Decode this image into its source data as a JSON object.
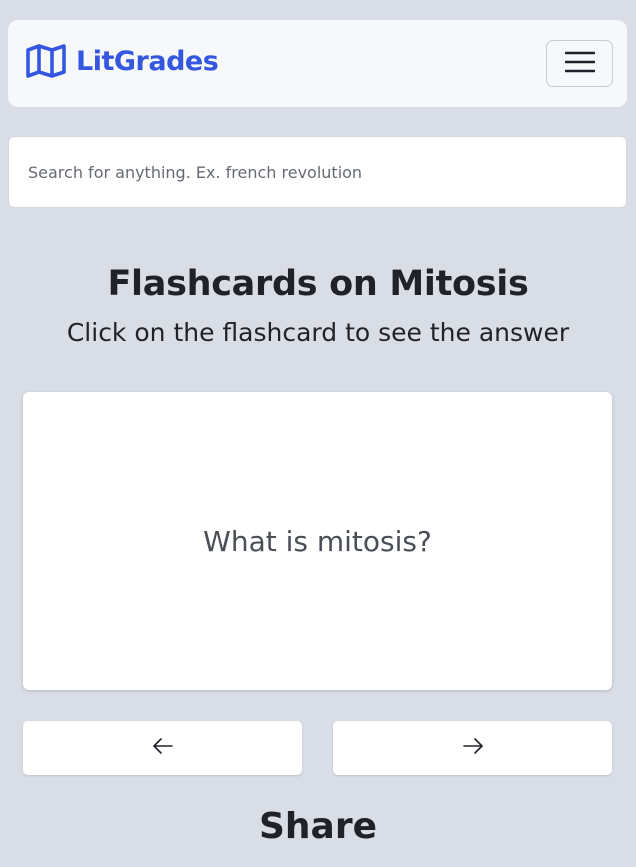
{
  "header": {
    "brand_name": "LitGrades",
    "brand_icon": "open-map-icon",
    "menu_icon": "hamburger-menu-icon"
  },
  "search": {
    "placeholder": "Search for anything. Ex. french revolution",
    "value": ""
  },
  "main": {
    "title": "Flashcards on Mitosis",
    "subtitle": "Click on the flashcard to see the answer"
  },
  "flashcard": {
    "question": "What is mitosis?"
  },
  "navigation": {
    "prev_icon": "arrow-left-icon",
    "next_icon": "arrow-right-icon"
  },
  "share": {
    "heading": "Share"
  },
  "colors": {
    "background": "#d9dde6",
    "brand": "#3557e0",
    "card": "#ffffff",
    "text": "#1f2329"
  }
}
